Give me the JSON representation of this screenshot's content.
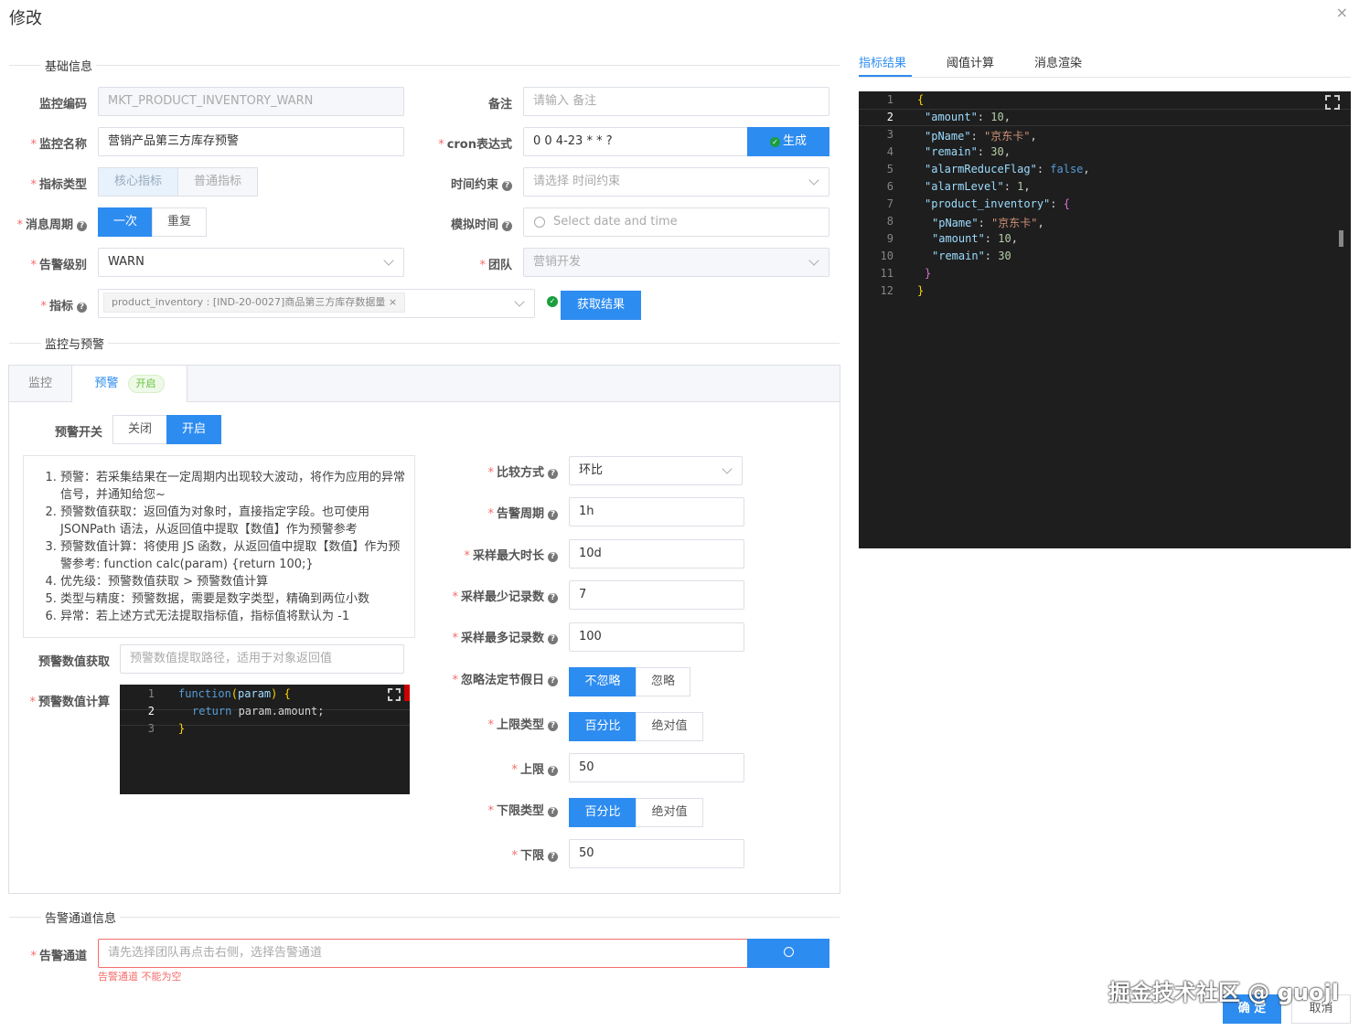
{
  "dialog": {
    "title": "修改",
    "close": "×"
  },
  "sections": {
    "basic": "基础信息",
    "monitor": "监控与预警",
    "channel": "告警通道信息"
  },
  "basic": {
    "code_label": "监控编码",
    "code_value": "MKT_PRODUCT_INVENTORY_WARN",
    "remark_label": "备注",
    "remark_placeholder": "请输入 备注",
    "name_label": "监控名称",
    "name_value": "营销产品第三方库存预警",
    "cron_label": "cron表达式",
    "cron_value": "0 0 4-23 * * ?",
    "cron_btn": "生成",
    "type_label": "指标类型",
    "type_opts": [
      "核心指标",
      "普通指标"
    ],
    "time_label": "时间约束",
    "time_placeholder": "请选择 时间约束",
    "period_label": "消息周期",
    "period_opts": [
      "一次",
      "重复"
    ],
    "sim_label": "模拟时间",
    "sim_placeholder": "Select date and time",
    "level_label": "告警级别",
    "level_value": "WARN",
    "team_label": "团队",
    "team_value": "营销开发",
    "metric_label": "指标",
    "metric_tag": "product_inventory : [IND-20-0027]商品第三方库存数据量",
    "metric_btn": "获取结果"
  },
  "monitor_tabs": {
    "monitor": "监控",
    "alert": "预警",
    "alert_tag": "开启"
  },
  "alert": {
    "switch_label": "预警开关",
    "switch_opts": [
      "关闭",
      "开启"
    ],
    "help": [
      "预警：若采集结果在一定周期内出现较大波动，将作为应用的异常信号，并通知给您~",
      "预警数值获取：返回值为对象时，直接指定字段。也可使用 JSONPath 语法，从返回值中提取【数值】作为预警参考",
      "预警数值计算：将使用 JS 函数，从返回值中提取【数值】作为预警参考: function calc(param) {return 100;}",
      "优先级：预警数值获取 > 预警数值计算",
      "类型与精度：预警数据，需要是数字类型，精确到两位小数",
      "异常：若上述方式无法提取指标值，指标值将默认为 -1"
    ],
    "get_label": "预警数值获取",
    "get_placeholder": "预警数值提取路径，适用于对象返回值",
    "calc_label": "预警数值计算",
    "compare_label": "比较方式",
    "compare_value": "环比",
    "period_label": "告警周期",
    "period_value": "1h",
    "maxdur_label": "采样最大时长",
    "maxdur_value": "10d",
    "minrec_label": "采样最少记录数",
    "minrec_value": "7",
    "maxrec_label": "采样最多记录数",
    "maxrec_value": "100",
    "holiday_label": "忽略法定节假日",
    "holiday_opts": [
      "不忽略",
      "忽略"
    ],
    "uptype_label": "上限类型",
    "uptype_opts": [
      "百分比",
      "绝对值"
    ],
    "up_label": "上限",
    "up_value": "50",
    "lowtype_label": "下限类型",
    "lowtype_opts": [
      "百分比",
      "绝对值"
    ],
    "low_label": "下限",
    "low_value": "50"
  },
  "channel": {
    "label": "告警通道",
    "placeholder": "请先选择团队再点击右侧，选择告警通道",
    "error": "告警通道 不能为空"
  },
  "right_tabs": [
    "指标结果",
    "阈值计算",
    "消息渲染"
  ],
  "footer": {
    "ok": "确 定",
    "cancel": "取消",
    "watermark": "掘金技术社区 @ guojl"
  },
  "code_small": {
    "lines": [
      "1",
      "2",
      "3"
    ],
    "l1a": "function",
    "l1b": "(",
    "l1c": "param",
    "l1d": ")",
    "l1e": " {",
    "l2a": "return",
    "l2b": " param.amount;",
    "l3": "}"
  },
  "code_json": {
    "lines": [
      "1",
      "2",
      "3",
      "4",
      "5",
      "6",
      "7",
      "8",
      "9",
      "10",
      "11",
      "12"
    ],
    "open": "{",
    "amount_k": "\"amount\"",
    "amount_v": "10",
    "pname_k": "\"pName\"",
    "pname_v": "\"京东卡\"",
    "remain_k": "\"remain\"",
    "remain_v": "30",
    "arf_k": "\"alarmReduceFlag\"",
    "arf_v": "false",
    "al_k": "\"alarmLevel\"",
    "al_v": "1",
    "pi_k": "\"product_inventory\"",
    "pi_open": "{",
    "pi_pname_k": "\"pName\"",
    "pi_pname_v": "\"京东卡\"",
    "pi_amount_k": "\"amount\"",
    "pi_amount_v": "10",
    "pi_remain_k": "\"remain\"",
    "pi_remain_v": "30",
    "pi_close": "}",
    "close": "}"
  }
}
